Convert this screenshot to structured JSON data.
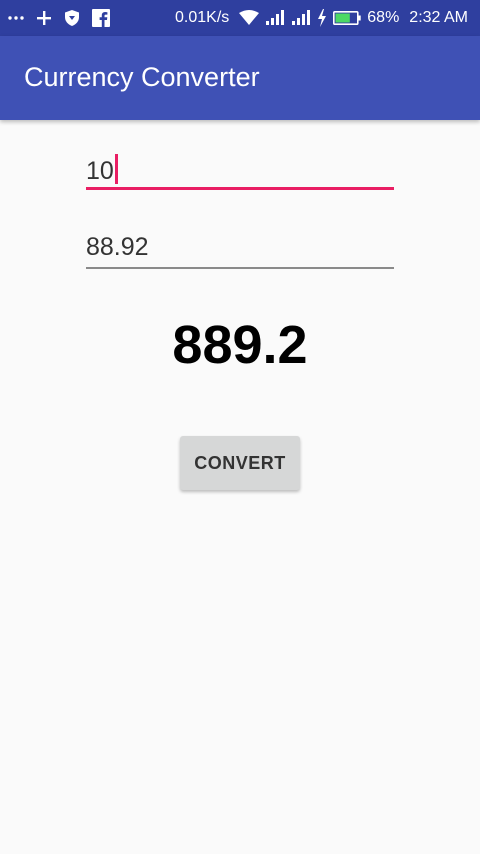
{
  "status_bar": {
    "net_speed": "0.01K/s",
    "battery_percent": "68%",
    "battery_level": 0.68,
    "time": "2:32 AM",
    "icons": [
      "more-dots-icon",
      "plus-icon",
      "shield-icon",
      "facebook-icon",
      "wifi-icon",
      "signal-icon",
      "signal-icon",
      "charging-icon",
      "battery-icon"
    ]
  },
  "app_bar": {
    "title": "Currency Converter"
  },
  "form": {
    "amount_value": "10",
    "rate_value": "88.92"
  },
  "result": {
    "value": "889.2"
  },
  "actions": {
    "convert_label": "CONVERT"
  },
  "colors": {
    "status_bar": "#2f3f9f",
    "app_bar": "#3f51b5",
    "accent": "#e91e63",
    "background": "#fafafa",
    "button": "#d6d7d7"
  }
}
